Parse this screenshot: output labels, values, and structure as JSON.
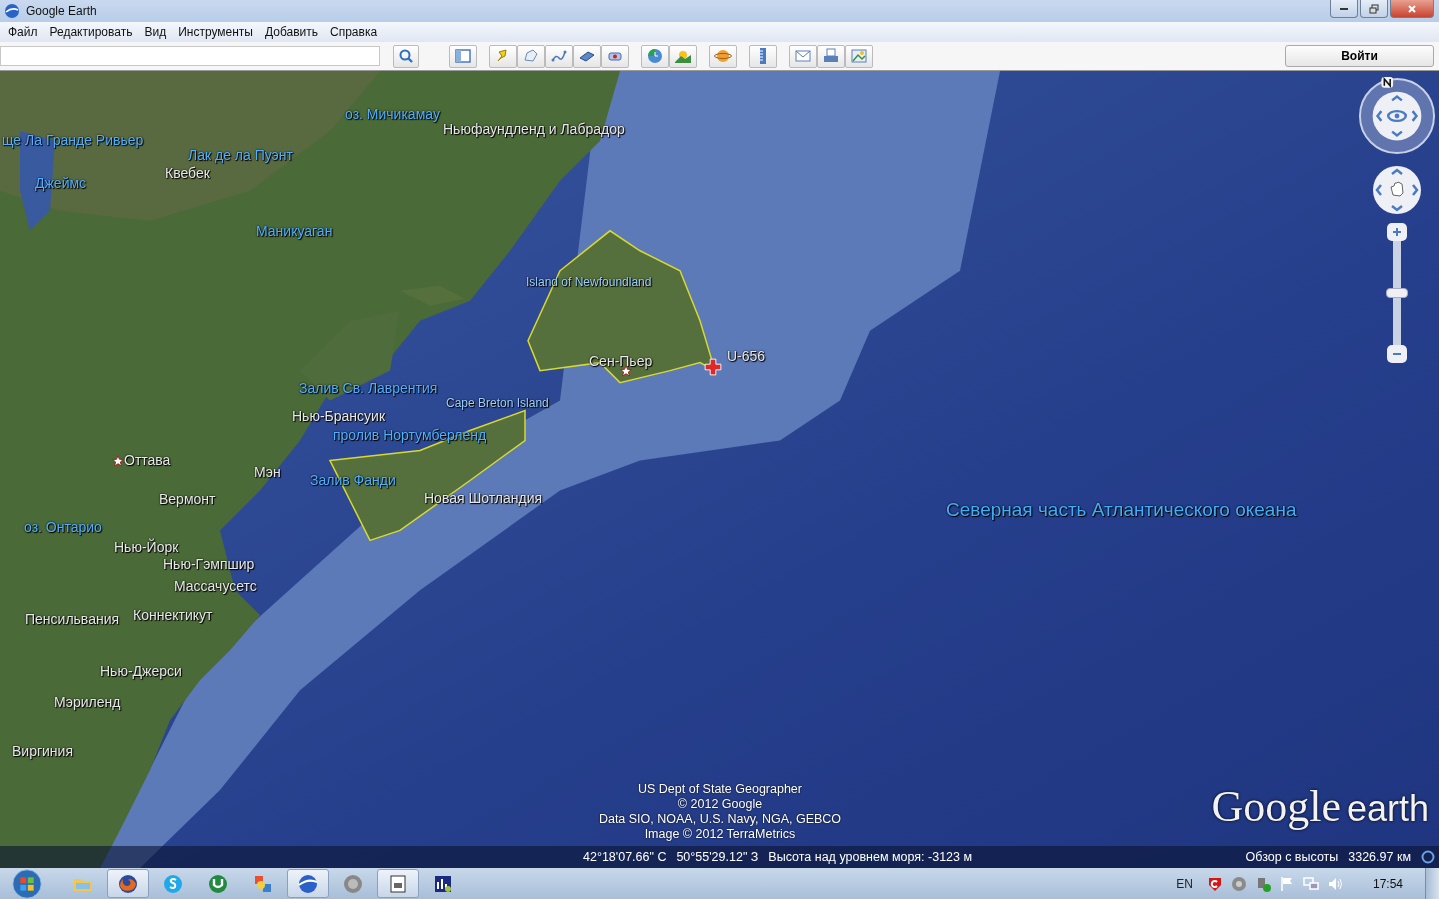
{
  "window": {
    "title": "Google Earth"
  },
  "menu": [
    {
      "label": "Файл"
    },
    {
      "label": "Редактировать"
    },
    {
      "label": "Вид"
    },
    {
      "label": "Инструменты"
    },
    {
      "label": "Добавить"
    },
    {
      "label": "Справка"
    }
  ],
  "toolbar": {
    "sign_in": "Войти"
  },
  "map": {
    "labels": [
      {
        "text": "оз. Мичикамау",
        "kind": "water"
      },
      {
        "text": "Ньюфаундленд и Лабрадор",
        "kind": "land"
      },
      {
        "text": "ще Ла Гранде Ривьер",
        "kind": "water"
      },
      {
        "text": "Лак де ла Пуэнт",
        "kind": "water"
      },
      {
        "text": "Джеймс",
        "kind": "water"
      },
      {
        "text": "Квебек",
        "kind": "land"
      },
      {
        "text": "Маникуаган",
        "kind": "water"
      },
      {
        "text": "Island of Newfoundland",
        "kind": "island"
      },
      {
        "text": "Сен-Пьер",
        "kind": "capital"
      },
      {
        "text": "U-656",
        "kind": "placemark"
      },
      {
        "text": "Залив Св. Лаврентия",
        "kind": "water"
      },
      {
        "text": "Нью-Брансуик",
        "kind": "land"
      },
      {
        "text": "Cape Breton Island",
        "kind": "island"
      },
      {
        "text": "пролив Нортумберленд",
        "kind": "water"
      },
      {
        "text": "Оттава",
        "kind": "capital"
      },
      {
        "text": "Мэн",
        "kind": "land"
      },
      {
        "text": "Залив Фанди",
        "kind": "water"
      },
      {
        "text": "Вермонт",
        "kind": "land"
      },
      {
        "text": "Новая Шотландия",
        "kind": "land"
      },
      {
        "text": "Северная часть Атлантического океана",
        "kind": "ocean"
      },
      {
        "text": "оз. Онтарио",
        "kind": "water"
      },
      {
        "text": "Нью-Йорк",
        "kind": "land"
      },
      {
        "text": "Нью-Гэмпшир",
        "kind": "land"
      },
      {
        "text": "Массачусетс",
        "kind": "land"
      },
      {
        "text": "Пенсильвания",
        "kind": "land"
      },
      {
        "text": "Коннектикут",
        "kind": "land"
      },
      {
        "text": "Нью-Джерси",
        "kind": "land"
      },
      {
        "text": "Мэриленд",
        "kind": "land"
      },
      {
        "text": "Виргиния",
        "kind": "land"
      }
    ],
    "attribution": [
      "US Dept of State Geographer",
      "© 2012 Google",
      "Data SIO, NOAA, U.S. Navy, NGA, GEBCO",
      "Image © 2012 TerraMetrics"
    ],
    "logo": {
      "brand": "Google",
      "product": "earth"
    },
    "zoom": {
      "level": 0.5
    }
  },
  "status_bar": {
    "latitude": "42°18'07.66\" С",
    "longitude": "50°55'29.12\" З",
    "elevation": "Высота над уровнем моря: -3123 м",
    "eye_alt_label": "Обзор с высоты",
    "eye_alt": "3326.97 км"
  },
  "taskbar": {
    "apps": [
      {
        "kind": "folder",
        "active": false
      },
      {
        "kind": "firefox",
        "active": true
      },
      {
        "kind": "skype",
        "active": false
      },
      {
        "kind": "torrent",
        "active": false
      },
      {
        "kind": "tools",
        "active": false
      },
      {
        "kind": "earth",
        "active": true
      },
      {
        "kind": "disc",
        "active": false
      },
      {
        "kind": "window",
        "active": true
      },
      {
        "kind": "meter",
        "active": false
      }
    ],
    "language": "EN",
    "clock": "17:54"
  }
}
